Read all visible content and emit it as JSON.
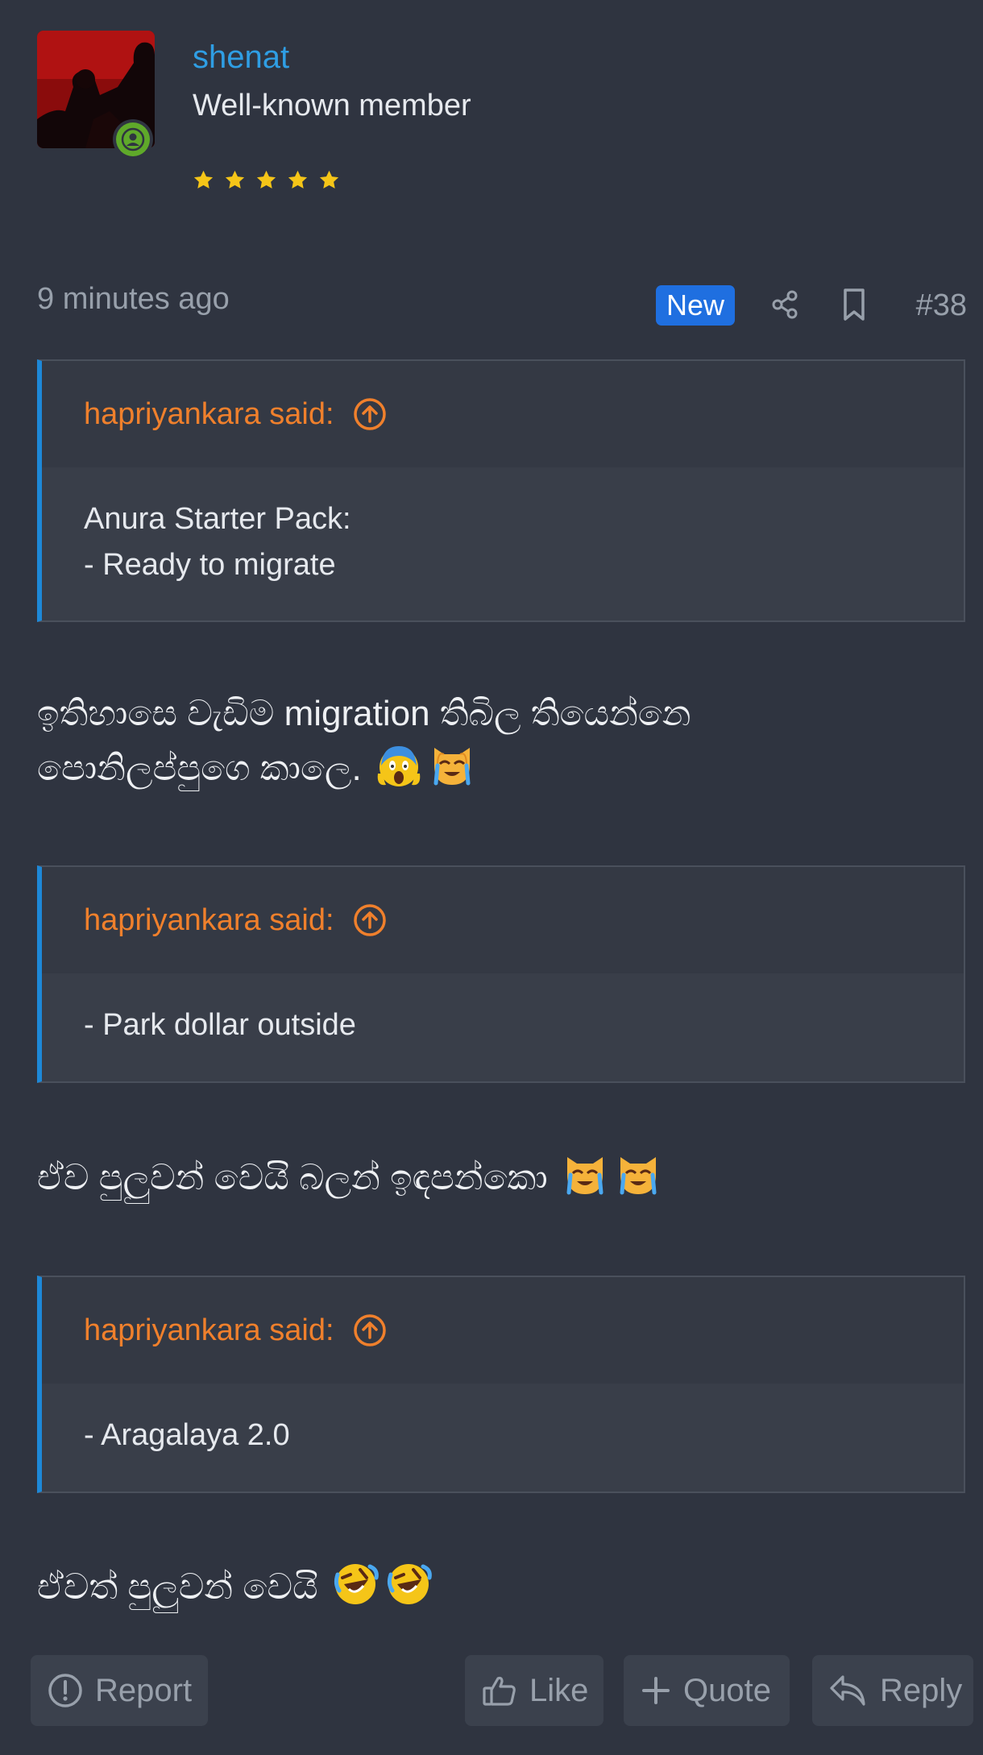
{
  "user": {
    "name": "shenat",
    "title": "Well-known member",
    "online": true,
    "star_count": 5
  },
  "meta": {
    "time": "9 minutes ago",
    "new_badge": "New",
    "post_number": "#38"
  },
  "quotes": [
    {
      "attribution": "hapriyankara said:",
      "lines": [
        "Anura Starter Pack:",
        "- Ready to migrate"
      ]
    },
    {
      "attribution": "hapriyankara said:",
      "lines": [
        "- Park dollar outside"
      ]
    },
    {
      "attribution": "hapriyankara said:",
      "lines": [
        "- Aragalaya 2.0"
      ]
    }
  ],
  "replies": [
    {
      "line1": "ඉතිහාසෙ වැඩිම migration තිබිල තියෙන්නෙ",
      "line2": "පොනිලප්පුගෙ කාලෙ.",
      "emojis": [
        "face-screaming-in-fear",
        "crying-cat-face"
      ]
    },
    {
      "text": "ඒව පුලුවන් වෙයි බලන් ඉඳපන්කො",
      "emojis": [
        "crying-cat-face",
        "crying-cat-face"
      ]
    },
    {
      "text": "ඒවත් පුලුවන් වෙයි",
      "emojis": [
        "rolling-on-the-floor-laughing",
        "rolling-on-the-floor-laughing"
      ]
    }
  ],
  "actions": {
    "report": "Report",
    "like": "Like",
    "quote": "Quote",
    "reply": "Reply"
  },
  "colors": {
    "background": "#2f3440",
    "username": "#2f9ee4",
    "quote_attribution": "#f0802c",
    "quote_border": "#1d88d8",
    "new_badge": "#1f6fe0",
    "star": "#f5c518",
    "online": "#5fa92a"
  }
}
